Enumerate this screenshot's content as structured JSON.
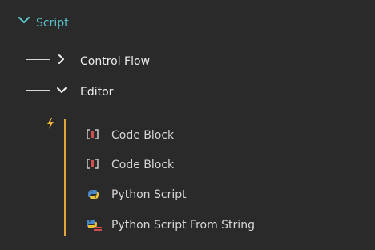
{
  "header": {
    "label": "Script",
    "icon": "chevron-down-icon",
    "color": "#59c2c7"
  },
  "children": [
    {
      "label": "Control Flow",
      "expanded": false,
      "icon": "chevron-right-icon"
    },
    {
      "label": "Editor",
      "expanded": true,
      "icon": "chevron-down-icon"
    }
  ],
  "editor_group": {
    "marker_icon": "lightning-icon",
    "accent": "#e3a43a",
    "items": [
      {
        "label": "Code Block",
        "icon": "code-block-icon"
      },
      {
        "label": "Code Block",
        "icon": "code-block-icon"
      },
      {
        "label": "Python Script",
        "icon": "python-icon"
      },
      {
        "label": "Python Script From String",
        "icon": "python-string-icon"
      }
    ]
  }
}
